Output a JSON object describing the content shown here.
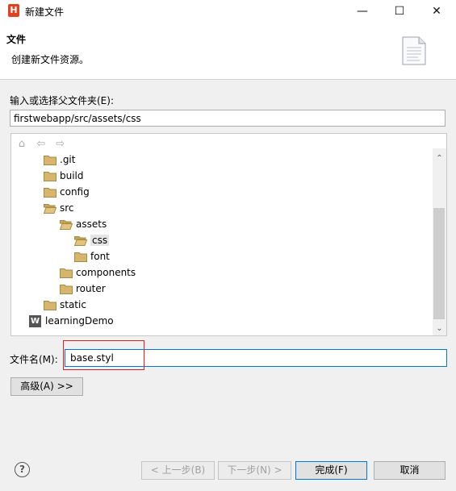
{
  "window": {
    "title": "新建文件",
    "app_icon_letter": "H",
    "controls": {
      "minimize": "—",
      "maximize": "☐",
      "close": "✕"
    }
  },
  "header": {
    "title": "文件",
    "description": "创建新文件资源。"
  },
  "parent_folder": {
    "label": "输入或选择父文件夹(E):",
    "value": "firstwebapp/src/assets/css"
  },
  "tree": {
    "toolbar_icons": [
      "home-icon",
      "back-arrow-icon",
      "forward-arrow-icon"
    ],
    "items": [
      {
        "label": ".git",
        "depth": 1,
        "type": "folder"
      },
      {
        "label": "build",
        "depth": 1,
        "type": "folder"
      },
      {
        "label": "config",
        "depth": 1,
        "type": "folder"
      },
      {
        "label": "src",
        "depth": 1,
        "type": "folder-open"
      },
      {
        "label": "assets",
        "depth": 2,
        "type": "folder-open"
      },
      {
        "label": "css",
        "depth": 3,
        "type": "folder-open",
        "selected": true
      },
      {
        "label": "font",
        "depth": 3,
        "type": "folder"
      },
      {
        "label": "components",
        "depth": 2,
        "type": "folder"
      },
      {
        "label": "router",
        "depth": 2,
        "type": "folder"
      },
      {
        "label": "static",
        "depth": 1,
        "type": "folder"
      },
      {
        "label": "learningDemo",
        "depth": 0,
        "type": "project"
      }
    ]
  },
  "file_name": {
    "label": "文件名(M):",
    "value": "base.styl"
  },
  "buttons": {
    "advanced": "高级(A) >>",
    "back": "< 上一步(B)",
    "next": "下一步(N) >",
    "finish": "完成(F)",
    "cancel": "取消"
  },
  "help_icon_glyph": "?",
  "colors": {
    "accent": "#0078d7",
    "highlight_box": "#e02020",
    "folder": "#d7b56d",
    "app_icon": "#e1421f"
  }
}
